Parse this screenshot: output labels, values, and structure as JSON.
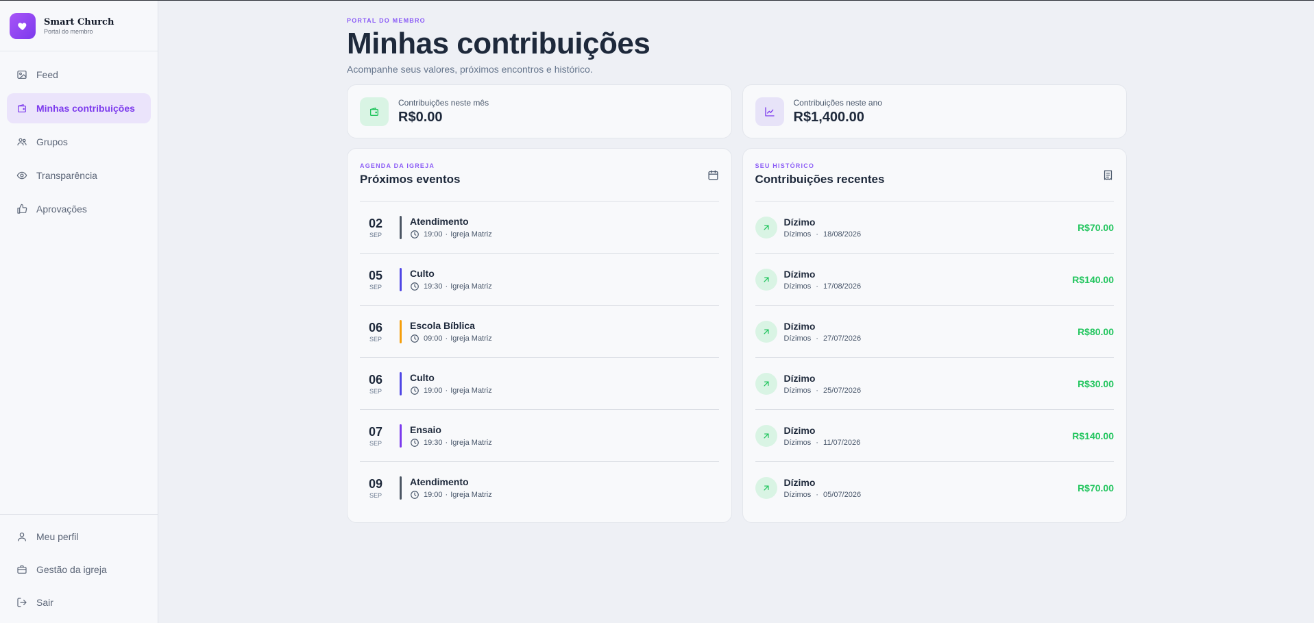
{
  "brand": {
    "name": "Smart Church",
    "subtitle": "Portal do membro"
  },
  "nav": [
    {
      "label": "Feed",
      "icon": "image-icon",
      "active": false
    },
    {
      "label": "Minhas contribuições",
      "icon": "wallet-icon",
      "active": true
    },
    {
      "label": "Grupos",
      "icon": "users-icon",
      "active": false
    },
    {
      "label": "Transparência",
      "icon": "eye-icon",
      "active": false
    },
    {
      "label": "Aprovações",
      "icon": "thumbs-up-icon",
      "active": false
    }
  ],
  "nav_bottom": [
    {
      "label": "Meu perfil",
      "icon": "user-icon"
    },
    {
      "label": "Gestão da igreja",
      "icon": "briefcase-icon"
    },
    {
      "label": "Sair",
      "icon": "logout-icon"
    }
  ],
  "header": {
    "eyebrow": "PORTAL DO MEMBRO",
    "title": "Minhas contribuições",
    "subtitle": "Acompanhe seus valores, próximos encontros e histórico."
  },
  "stats": [
    {
      "label": "Contribuições neste mês",
      "value": "R$0.00",
      "icon": "wallet-icon"
    },
    {
      "label": "Contribuições neste ano",
      "value": "R$1,400.00",
      "icon": "chart-up-icon"
    }
  ],
  "events_panel": {
    "eyebrow": "AGENDA DA IGREJA",
    "title": "Próximos eventos",
    "items": [
      {
        "day": "02",
        "month": "SEP",
        "title": "Atendimento",
        "time": "19:00",
        "place": "Igreja Matriz",
        "color": "#4b5563"
      },
      {
        "day": "05",
        "month": "SEP",
        "title": "Culto",
        "time": "19:30",
        "place": "Igreja Matriz",
        "color": "#4f46e5"
      },
      {
        "day": "06",
        "month": "SEP",
        "title": "Escola Bíblica",
        "time": "09:00",
        "place": "Igreja Matriz",
        "color": "#f59e0b"
      },
      {
        "day": "06",
        "month": "SEP",
        "title": "Culto",
        "time": "19:00",
        "place": "Igreja Matriz",
        "color": "#4f46e5"
      },
      {
        "day": "07",
        "month": "SEP",
        "title": "Ensaio",
        "time": "19:30",
        "place": "Igreja Matriz",
        "color": "#7c3aed"
      },
      {
        "day": "09",
        "month": "SEP",
        "title": "Atendimento",
        "time": "19:00",
        "place": "Igreja Matriz",
        "color": "#4b5563"
      }
    ]
  },
  "contrib_panel": {
    "eyebrow": "SEU HISTÓRICO",
    "title": "Contribuições recentes",
    "items": [
      {
        "title": "Dízimo",
        "category": "Dízimos",
        "date": "18/08/2026",
        "amount": "R$70.00"
      },
      {
        "title": "Dízimo",
        "category": "Dízimos",
        "date": "17/08/2026",
        "amount": "R$140.00"
      },
      {
        "title": "Dízimo",
        "category": "Dízimos",
        "date": "27/07/2026",
        "amount": "R$80.00"
      },
      {
        "title": "Dízimo",
        "category": "Dízimos",
        "date": "25/07/2026",
        "amount": "R$30.00"
      },
      {
        "title": "Dízimo",
        "category": "Dízimos",
        "date": "11/07/2026",
        "amount": "R$140.00"
      },
      {
        "title": "Dízimo",
        "category": "Dízimos",
        "date": "05/07/2026",
        "amount": "R$70.00"
      }
    ]
  },
  "colors": {
    "accent": "#7c3aed",
    "positive": "#22c55e",
    "background": "#eef0f5"
  }
}
